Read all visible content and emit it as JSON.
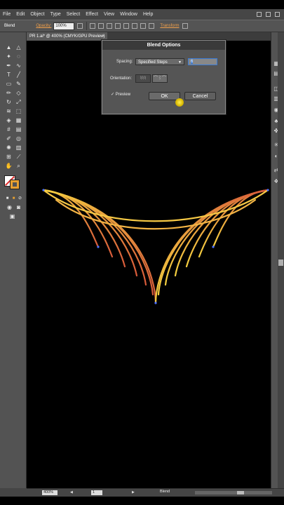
{
  "menu": [
    "File",
    "Edit",
    "Object",
    "Type",
    "Select",
    "Effect",
    "View",
    "Window",
    "Help"
  ],
  "control_bar": {
    "mode_label": "Blend",
    "opacity_label": "Opacity:",
    "opacity_value": "100%",
    "transform_label": "Transform"
  },
  "document_tab": {
    "title": "PR 1.ai* @ 400% (CMYK/GPU Preview)",
    "close": "×"
  },
  "dialog": {
    "title": "Blend Options",
    "spacing_label": "Spacing:",
    "spacing_value": "Specified Steps",
    "steps_value": "6",
    "orientation_label": "Orientation:",
    "preview_label": "Preview",
    "preview_checked": true,
    "ok_label": "OK",
    "cancel_label": "Cancel"
  },
  "status_bar": {
    "zoom": "400%",
    "page": "1",
    "tool": "Blend"
  },
  "colors": {
    "accent": "#f2a04a",
    "blend_start": "#f5d040",
    "blend_end": "#d85a3a",
    "stroke_swatch": "#e8a030"
  }
}
